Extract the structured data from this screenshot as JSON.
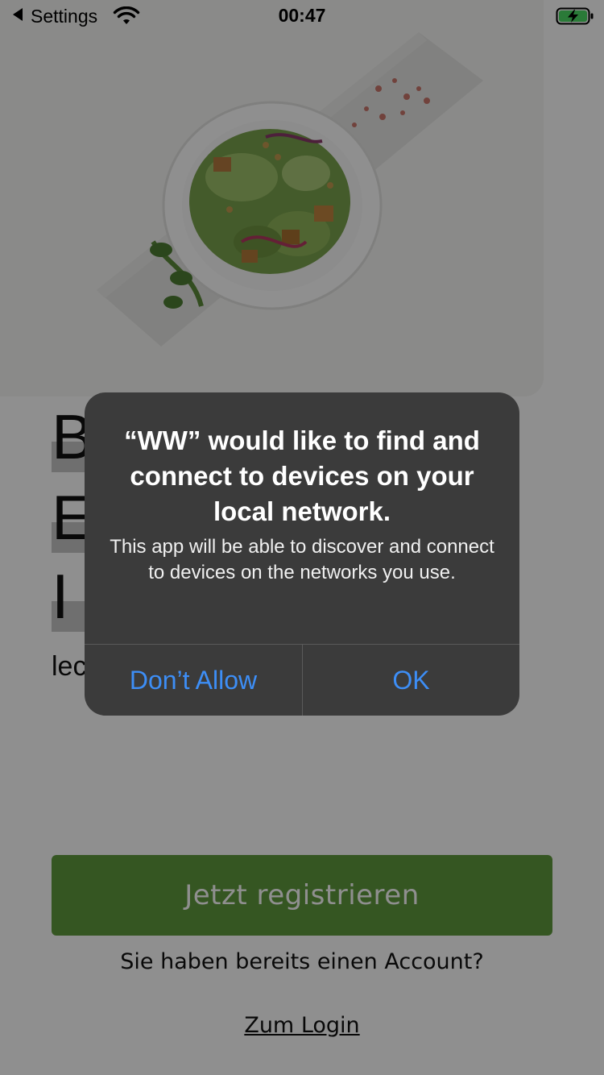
{
  "status_bar": {
    "back_label": "Settings",
    "time": "00:47"
  },
  "hero": {
    "image": "salad-bowl-photo"
  },
  "headline": {
    "lines": [
      "B",
      "E",
      "I"
    ]
  },
  "subtext": "lec",
  "actions": {
    "register_label": "Jetzt registrieren",
    "account_question": "Sie haben bereits einen Account?",
    "login_link": "Zum Login"
  },
  "alert": {
    "title": "“WW” would like to find and connect to devices on your local network.",
    "message": "This app will be able to discover and connect to devices on the networks you use.",
    "deny_label": "Don’t Allow",
    "ok_label": "OK"
  },
  "colors": {
    "accent_green": "#5f9a3e",
    "alert_bg": "#3b3b3b",
    "alert_button_text": "#3d8ef6"
  }
}
